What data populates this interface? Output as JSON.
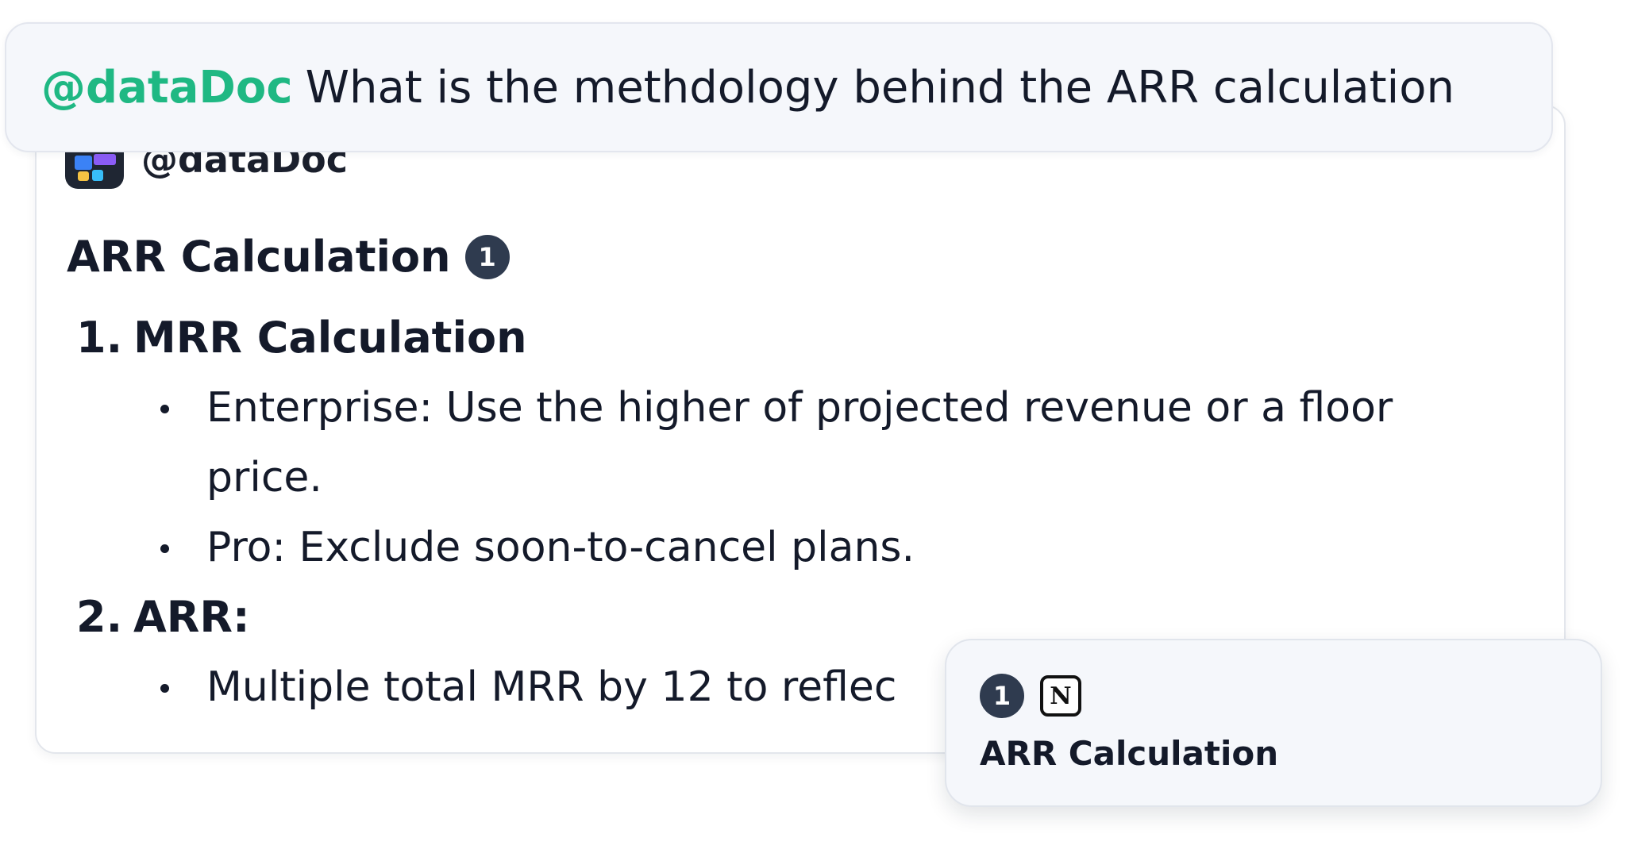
{
  "question": {
    "mention": "@dataDoc",
    "text": "What is the methdology behind the ARR calculation"
  },
  "answer": {
    "bot_name": "@dataDoc",
    "bot_icon": "app-logo-icon",
    "title": "ARR Calculation",
    "citation_number": "1",
    "steps": [
      {
        "number": "1.",
        "heading": "MRR Calculation",
        "bullets": [
          "Enterprise: Use the higher of projected revenue or a floor price.",
          "Pro: Exclude soon-to-cancel plans."
        ]
      },
      {
        "number": "2.",
        "heading": "ARR:",
        "bullets": [
          "Multiple total MRR by 12 to reflec"
        ]
      }
    ]
  },
  "citation_popover": {
    "number": "1",
    "source_icon": "notion-icon",
    "source_glyph": "N",
    "title": "ARR Calculation"
  },
  "colors": {
    "mention": "#1fb883",
    "badge": "#2f3b4f",
    "bubble_bg": "#f5f7fb"
  }
}
